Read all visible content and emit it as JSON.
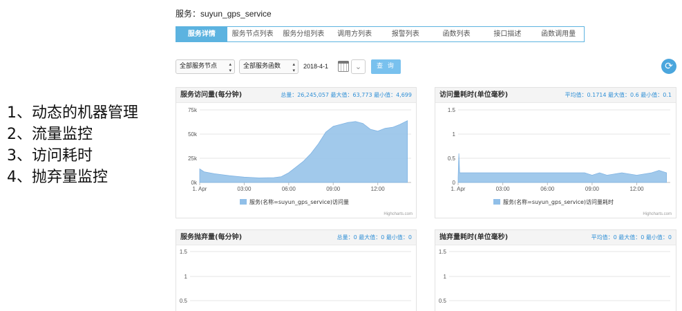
{
  "notes": [
    "1、动态的机器管理",
    "2、流量监控",
    "3、访问耗时",
    "4、抛弃量监控"
  ],
  "service_title": "服务：suyun_gps_service",
  "tabs": [
    {
      "label": "服务详情",
      "active": true
    },
    {
      "label": "服务节点列表",
      "active": false
    },
    {
      "label": "服务分组列表",
      "active": false
    },
    {
      "label": "调用方列表",
      "active": false
    },
    {
      "label": "报警列表",
      "active": false
    },
    {
      "label": "函数列表",
      "active": false
    },
    {
      "label": "接口描述",
      "active": false
    },
    {
      "label": "函数调用量",
      "active": false
    }
  ],
  "filters": {
    "node_select": "全部服务节点",
    "function_select": "全部服务函数",
    "date": "2018-4-1",
    "query_button": "查 询"
  },
  "colors": {
    "accent": "#5cb3e0",
    "series": "#90bfe8",
    "stats": "#2f8fd6"
  },
  "panels": {
    "visits": {
      "title": "服务访问量(每分钟)",
      "stats": "总量：26,245,057 最大值：63,773 最小值：4,699",
      "legend": "服务(名称=suyun_gps_service)访问量",
      "credit": "Highcharts.com"
    },
    "latency": {
      "title": "访问量耗时(单位毫秒)",
      "stats": "平均值：0.1714 最大值：0.6 最小值：0.1",
      "legend": "服务(名称=suyun_gps_service)访问量耗时",
      "credit": "Highcharts.com"
    },
    "discard": {
      "title": "服务抛弃量(每分钟)",
      "stats": "总量：0 最大值：0 最小值：0"
    },
    "discard_latency": {
      "title": "抛弃量耗时(单位毫秒)",
      "stats": "平均值：0 最大值：0 最小值：0"
    }
  },
  "chart_data": [
    {
      "type": "area",
      "title": "服务访问量(每分钟)",
      "x_ticks": [
        "1. Apr",
        "03:00",
        "06:00",
        "09:00",
        "12:00"
      ],
      "y_ticks": [
        "0k",
        "25k",
        "50k",
        "75k"
      ],
      "ylim": [
        0,
        75000
      ],
      "series": [
        {
          "name": "服务(名称=suyun_gps_service)访问量",
          "x_hours": [
            0,
            0.3,
            1,
            2,
            3,
            4,
            5,
            5.5,
            6,
            6.5,
            7,
            7.5,
            8,
            8.5,
            9,
            9.5,
            10,
            10.5,
            11,
            11.5,
            12,
            12.5,
            13,
            13.5,
            14
          ],
          "values": [
            14000,
            11000,
            9000,
            7000,
            5500,
            4700,
            5000,
            6000,
            10000,
            16000,
            22000,
            30000,
            40000,
            52000,
            58000,
            60000,
            62000,
            63000,
            61000,
            55000,
            53000,
            56000,
            57000,
            60000,
            63773
          ]
        }
      ]
    },
    {
      "type": "area",
      "title": "访问量耗时(单位毫秒)",
      "x_ticks": [
        "1. Apr",
        "03:00",
        "06:00",
        "09:00",
        "12:00"
      ],
      "y_ticks": [
        "0",
        "0.5",
        "1",
        "1.5"
      ],
      "ylim": [
        0,
        1.5
      ],
      "series": [
        {
          "name": "服务(名称=suyun_gps_service)访问量耗时",
          "x_hours": [
            0,
            0.05,
            0.1,
            0.15,
            1,
            3,
            6,
            8.5,
            9,
            9.5,
            10,
            11,
            12,
            13,
            13.5,
            14
          ],
          "values": [
            0.1,
            0.6,
            0.2,
            0.2,
            0.2,
            0.2,
            0.2,
            0.2,
            0.15,
            0.2,
            0.15,
            0.2,
            0.15,
            0.2,
            0.25,
            0.2
          ]
        }
      ]
    },
    {
      "type": "area",
      "title": "服务抛弃量(每分钟)",
      "y_ticks": [
        "0.5",
        "1",
        "1.5"
      ],
      "series": [
        {
          "values": []
        }
      ]
    },
    {
      "type": "area",
      "title": "抛弃量耗时(单位毫秒)",
      "y_ticks": [
        "0.5",
        "1",
        "1.5"
      ],
      "series": [
        {
          "values": []
        }
      ]
    }
  ]
}
